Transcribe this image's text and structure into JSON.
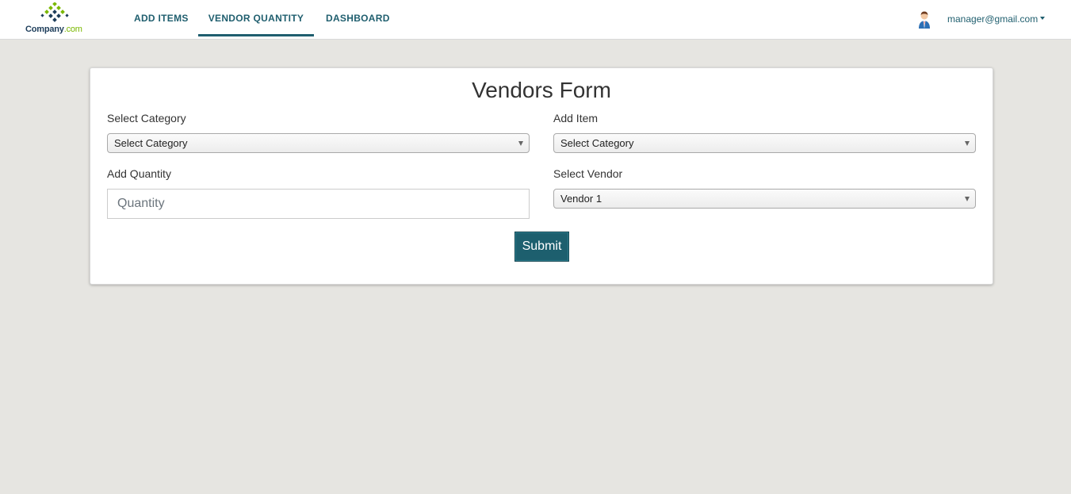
{
  "brand": {
    "name": "Company",
    "suffix": ".com",
    "accent": "#7ab800",
    "dark": "#1d3d5a"
  },
  "nav": {
    "items": [
      {
        "label": "ADD ITEMS",
        "active": false
      },
      {
        "label": "VENDOR QUANTITY",
        "active": true
      },
      {
        "label": "DASHBOARD",
        "active": false
      }
    ],
    "color": "#1f5e6e"
  },
  "user": {
    "email": "manager@gmail.com"
  },
  "form": {
    "title": "Vendors Form",
    "category": {
      "label": "Select Category",
      "selected": "Select Category"
    },
    "item": {
      "label": "Add Item",
      "selected": "Select Category"
    },
    "quantity": {
      "label": "Add Quantity",
      "placeholder": "Quantity",
      "value": ""
    },
    "vendor": {
      "label": "Select Vendor",
      "selected": "Vendor 1"
    },
    "submit_label": "Submit"
  },
  "colors": {
    "background": "#e6e5e1",
    "primary": "#1d5f6e"
  }
}
